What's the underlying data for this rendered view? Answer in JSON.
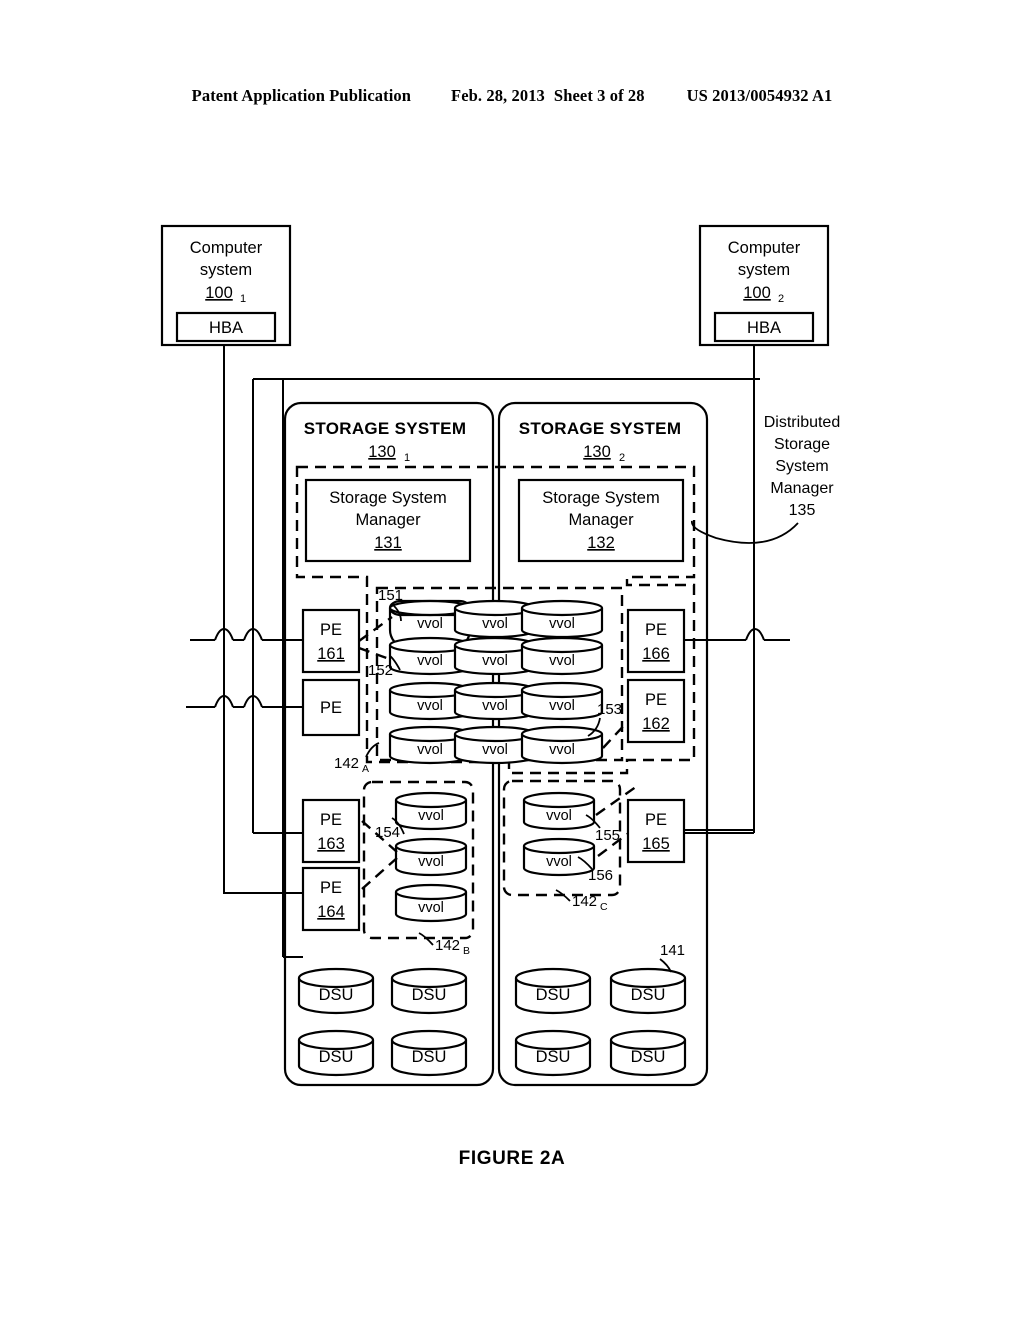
{
  "header": {
    "publication": "Patent Application Publication",
    "date": "Feb. 28, 2013",
    "sheet": "Sheet 3 of 28",
    "number": "US 2013/0054932 A1"
  },
  "figure": {
    "caption": "FIGURE 2A"
  },
  "computer_systems": [
    {
      "line1": "Computer",
      "line2": "system",
      "ref": "100",
      "ref_sub": "1",
      "hba": "HBA"
    },
    {
      "line1": "Computer",
      "line2": "system",
      "ref": "100",
      "ref_sub": "2",
      "hba": "HBA"
    }
  ],
  "distributed_manager": {
    "line1": "Distributed",
    "line2": "Storage",
    "line3": "System",
    "line4": "Manager",
    "ref": "135"
  },
  "storage_systems": [
    {
      "title": "STORAGE SYSTEM",
      "ref": "130",
      "ref_sub": "1",
      "manager": {
        "line1": "Storage System",
        "line2": "Manager",
        "ref": "131"
      }
    },
    {
      "title": "STORAGE SYSTEM",
      "ref": "130",
      "ref_sub": "2",
      "manager": {
        "line1": "Storage System",
        "line2": "Manager",
        "ref": "132"
      }
    }
  ],
  "protocol_endpoints": [
    {
      "label": "PE",
      "ref": "161"
    },
    {
      "label": "PE",
      "ref": ""
    },
    {
      "label": "PE",
      "ref": "163"
    },
    {
      "label": "PE",
      "ref": "164"
    },
    {
      "label": "PE",
      "ref": "166"
    },
    {
      "label": "PE",
      "ref": "162"
    },
    {
      "label": "PE",
      "ref": "165"
    }
  ],
  "vvol_label": "vvol",
  "dsu_label": "DSU",
  "vvol_groups": [
    {
      "id": "142A",
      "ref": "142",
      "ref_sub": "A",
      "rows": 4,
      "cols": 3,
      "count": 12
    },
    {
      "id": "142B",
      "ref": "142",
      "ref_sub": "B",
      "rows": 3,
      "cols": 1,
      "count": 3
    },
    {
      "id": "142C",
      "ref": "142",
      "ref_sub": "C",
      "rows": 2,
      "cols": 1,
      "count": 2
    }
  ],
  "callouts": {
    "c151": "151",
    "c152": "152",
    "c153": "153",
    "c154": "154",
    "c155": "155",
    "c156": "156",
    "c141": "141"
  },
  "dsu_banks": [
    {
      "system": "130-1",
      "count": 4
    },
    {
      "system": "130-2",
      "count": 4
    }
  ],
  "colors": {
    "ink": "#000000",
    "paper": "#ffffff"
  }
}
